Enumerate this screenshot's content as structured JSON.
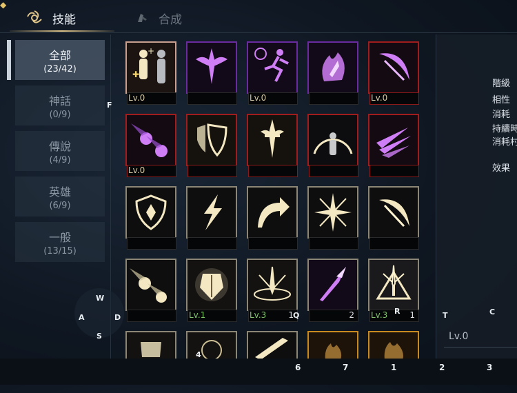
{
  "tabs": {
    "skills": "技能",
    "craft": "合成"
  },
  "categories": [
    {
      "name": "全部",
      "count": "(23/42)"
    },
    {
      "name": "神話",
      "count": "(0/9)"
    },
    {
      "name": "傳說",
      "count": "(4/9)"
    },
    {
      "name": "英雄",
      "count": "(6/9)"
    },
    {
      "name": "一般",
      "count": "(13/15)"
    }
  ],
  "skills": {
    "r0": [
      {
        "lv": "Lv.0",
        "rarity": "pink"
      },
      {
        "lv": "",
        "rarity": "purple"
      },
      {
        "lv": "Lv.0",
        "rarity": "purple"
      },
      {
        "lv": "",
        "rarity": "purple"
      },
      {
        "lv": "Lv.0",
        "rarity": "red"
      }
    ],
    "r1": [
      {
        "lv": "Lv.0",
        "rarity": "red"
      },
      {
        "lv": "",
        "rarity": "red"
      },
      {
        "lv": "",
        "rarity": "red"
      },
      {
        "lv": "",
        "rarity": "red"
      },
      {
        "lv": "",
        "rarity": "red"
      }
    ],
    "r2": [
      {
        "lv": "",
        "rarity": "gray"
      },
      {
        "lv": "",
        "rarity": "gray"
      },
      {
        "lv": "",
        "rarity": "gray"
      },
      {
        "lv": "",
        "rarity": "gray"
      },
      {
        "lv": "",
        "rarity": "gray"
      }
    ],
    "r3": [
      {
        "lv": "",
        "count": "",
        "rarity": "gray"
      },
      {
        "lv": "Lv.1",
        "count": "",
        "rarity": "gray"
      },
      {
        "lv": "Lv.3",
        "count": "1",
        "rarity": "gray"
      },
      {
        "lv": "",
        "count": "2",
        "rarity": "gray"
      },
      {
        "lv": "Lv.3",
        "count": "1",
        "rarity": "gray"
      }
    ]
  },
  "detail": {
    "labels": [
      "階級",
      "相性",
      "消耗",
      "持續時",
      "消耗村",
      "效果"
    ],
    "level": "Lv.0"
  },
  "keys": {
    "f": "F",
    "w": "W",
    "a": "A",
    "s": "S",
    "d": "D",
    "q": "Q",
    "r": "R",
    "t": "T",
    "c": "C",
    "four": "4",
    "hotkeys": [
      "6",
      "7",
      "1",
      "2",
      "3"
    ]
  }
}
